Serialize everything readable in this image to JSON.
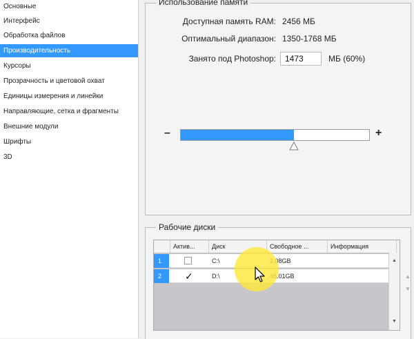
{
  "sidebar": {
    "items": [
      {
        "label": "Основные"
      },
      {
        "label": "Интерфейс"
      },
      {
        "label": "Обработка файлов"
      },
      {
        "label": "Производительность"
      },
      {
        "label": "Курсоры"
      },
      {
        "label": "Прозрачность и цветовой охват"
      },
      {
        "label": "Единицы измерения и линейки"
      },
      {
        "label": "Направляющие, сетка и фрагменты"
      },
      {
        "label": "Внешние модули"
      },
      {
        "label": "Шрифты"
      },
      {
        "label": "3D"
      }
    ],
    "selected_index": 3
  },
  "memory": {
    "title": "Использование памяти",
    "available_label": "Доступная память RAM:",
    "available_value": "2456 МБ",
    "optimal_label": "Оптимальный диапазон:",
    "optimal_value": "1350-1768 МБ",
    "used_label": "Занято под Photoshop:",
    "used_input": "1473",
    "used_suffix": "МБ (60%)",
    "slider_fraction": 0.6,
    "minus": "–",
    "plus": "+"
  },
  "disks": {
    "title": "Рабочие диски",
    "columns": [
      "Актив...",
      "Диск",
      "Свободное ...",
      "Информация"
    ],
    "rows": [
      {
        "num": "1",
        "active": false,
        "check": "",
        "disk": "C:\\",
        "free": "2.08GB"
      },
      {
        "num": "2",
        "active": true,
        "check": "✓",
        "disk": "D:\\",
        "free": "46.01GB"
      }
    ]
  },
  "colors": {
    "accent": "#3399ff",
    "highlight": "#fce83c"
  }
}
